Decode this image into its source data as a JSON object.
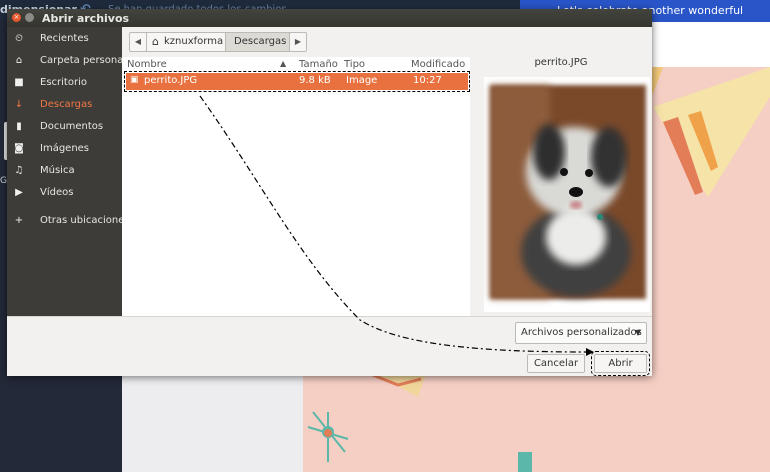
{
  "background": {
    "app_title": "dimensionar",
    "saved_status": "Se han guardado todos los cambios",
    "banner_text": "Let's celebrate another wonderful year",
    "side_letter": "G"
  },
  "dialog": {
    "title": "Abrir archivos",
    "places": [
      {
        "icon": "⏲",
        "label": "Recientes"
      },
      {
        "icon": "⌂",
        "label": "Carpeta personal"
      },
      {
        "icon": "■",
        "label": "Escritorio"
      },
      {
        "icon": "↓",
        "label": "Descargas"
      },
      {
        "icon": "▮",
        "label": "Documentos"
      },
      {
        "icon": "◙",
        "label": "Imágenes"
      },
      {
        "icon": "♫",
        "label": "Música"
      },
      {
        "icon": "▶",
        "label": "Vídeos"
      },
      {
        "icon": "+",
        "label": "Otras ubicaciones"
      }
    ],
    "active_place": "Descargas",
    "path": {
      "home_label": "kznuxforma",
      "current": "Descargas"
    },
    "columns": {
      "name": "Nombre",
      "size": "Tamaño",
      "type": "Tipo",
      "modified": "Modificado"
    },
    "files": [
      {
        "name": "perrito.JPG",
        "size": "9.8 kB",
        "type": "Image",
        "modified": "10:27"
      }
    ],
    "preview_name": "perrito.JPG",
    "filter": "Archivos personalizados",
    "cancel_label": "Cancelar",
    "open_label": "Abrir",
    "accent_color": "#e8713f"
  }
}
